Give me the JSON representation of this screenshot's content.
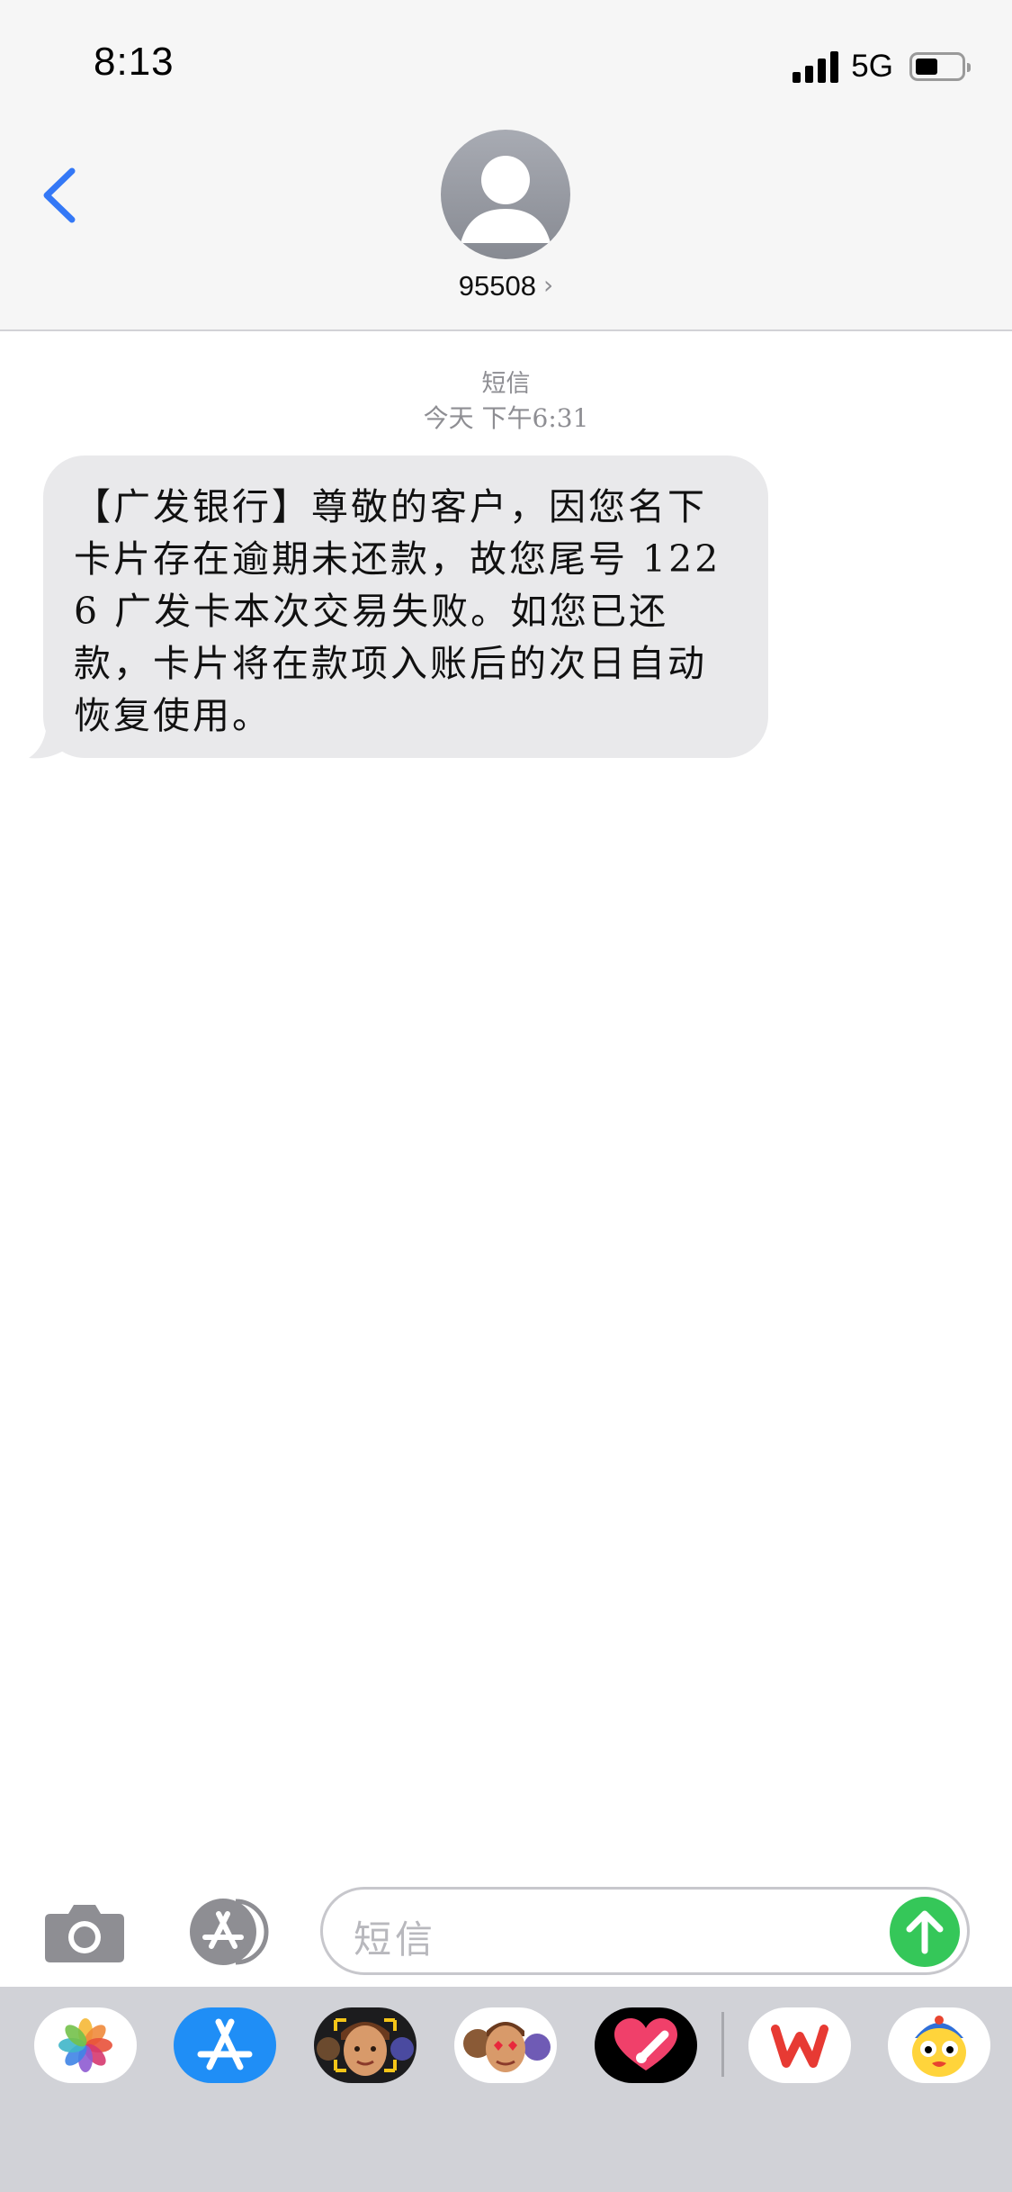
{
  "status_bar": {
    "time": "8:13",
    "network": "5G",
    "battery_level": 0.5
  },
  "header": {
    "contact_name": "95508",
    "icons": [
      "chevron-left-icon",
      "contact-avatar-icon",
      "chevron-right-icon"
    ]
  },
  "conversation": {
    "service": "短信",
    "timestamp": "今天 下午6:31",
    "messages": [
      {
        "direction": "incoming",
        "text": "【广发银行】尊敬的客户，因您名下卡片存在逾期未还款，故您尾号 1226 广发卡本次交易失败。如您已还款，卡片将在款项入账后的次日自动恢复使用。"
      }
    ]
  },
  "compose": {
    "placeholder": "短信",
    "icons": [
      "camera-icon",
      "app-store-icon",
      "send-arrow-icon"
    ]
  },
  "app_drawer": {
    "apps": [
      "photos-icon",
      "app-store-icon",
      "memoji-icon",
      "animoji-icon",
      "digital-touch-icon",
      "wps-icon",
      "cartoon-sticker-icon"
    ]
  },
  "colors": {
    "send": "#35c759",
    "accent": "#3478f6",
    "bubble": "#e9e9eb",
    "drawer": "#d1d2d7"
  }
}
